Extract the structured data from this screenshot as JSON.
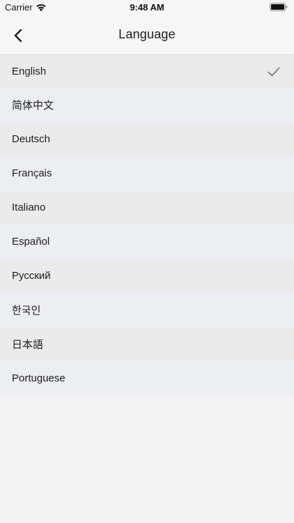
{
  "status_bar": {
    "carrier": "Carrier",
    "time": "9:48 AM",
    "wifi_icon": "wifi-icon",
    "battery_icon": "battery-full-icon"
  },
  "nav": {
    "title": "Language",
    "back_icon": "chevron-left-icon"
  },
  "languages": [
    {
      "label": "English",
      "selected": true
    },
    {
      "label": "简体中文",
      "selected": false
    },
    {
      "label": "Deutsch",
      "selected": false
    },
    {
      "label": "Français",
      "selected": false
    },
    {
      "label": "Italiano",
      "selected": false
    },
    {
      "label": "Español",
      "selected": false
    },
    {
      "label": "Русский",
      "selected": false
    },
    {
      "label": "한국인",
      "selected": false
    },
    {
      "label": "日本語",
      "selected": false
    },
    {
      "label": "Portuguese",
      "selected": false
    }
  ],
  "colors": {
    "checkmark": "#7d7d7d",
    "background": "#f2f2f2",
    "row_odd": "#ebebeb",
    "row_even": "#ebeef2"
  }
}
